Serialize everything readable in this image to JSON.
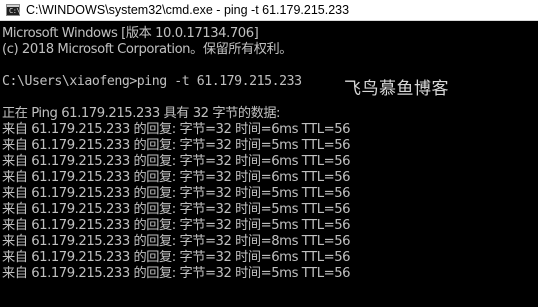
{
  "window": {
    "title": "C:\\WINDOWS\\system32\\cmd.exe - ping  -t 61.179.215.233",
    "icon": "cmd-icon",
    "icon_text": "C:\\"
  },
  "console": {
    "header": [
      "Microsoft Windows [版本 10.0.17134.706]",
      "(c) 2018 Microsoft Corporation。保留所有权利。"
    ],
    "command_line": "C:\\Users\\xiaofeng>ping -t 61.179.215.233",
    "ping_intro": "正在 Ping 61.179.215.233 具有 32 字节的数据:",
    "replies": [
      "来自 61.179.215.233 的回复: 字节=32 时间=6ms TTL=56",
      "来自 61.179.215.233 的回复: 字节=32 时间=5ms TTL=56",
      "来自 61.179.215.233 的回复: 字节=32 时间=6ms TTL=56",
      "来自 61.179.215.233 的回复: 字节=32 时间=6ms TTL=56",
      "来自 61.179.215.233 的回复: 字节=32 时间=5ms TTL=56",
      "来自 61.179.215.233 的回复: 字节=32 时间=5ms TTL=56",
      "来自 61.179.215.233 的回复: 字节=32 时间=5ms TTL=56",
      "来自 61.179.215.233 的回复: 字节=32 时间=8ms TTL=56",
      "来自 61.179.215.233 的回复: 字节=32 时间=6ms TTL=56",
      "来自 61.179.215.233 的回复: 字节=32 时间=5ms TTL=56"
    ]
  },
  "watermark": "飞鸟慕鱼博客",
  "colors": {
    "console_background": "#000000",
    "console_text": "#c0c0c0",
    "titlebar_background": "#ffffff"
  }
}
